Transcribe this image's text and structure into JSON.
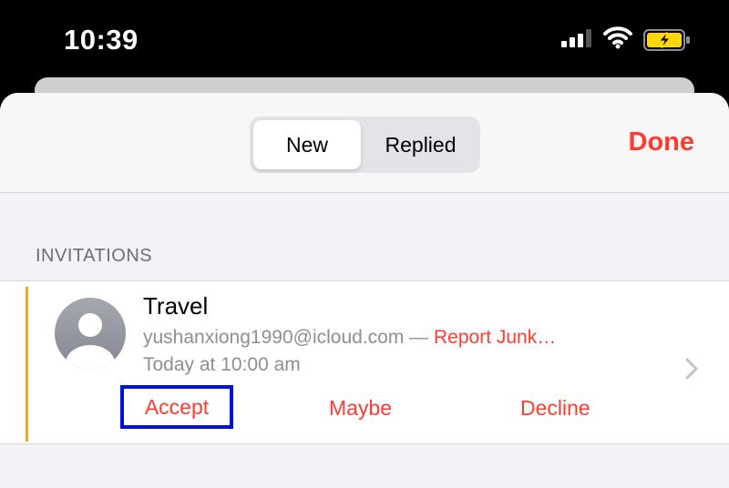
{
  "status_bar": {
    "time": "10:39"
  },
  "segments": {
    "new": "New",
    "replied": "Replied"
  },
  "nav": {
    "done": "Done"
  },
  "section": {
    "header": "INVITATIONS"
  },
  "invitation": {
    "title": "Travel",
    "email": "yushanxiong1990@icloud.com",
    "separator": " — ",
    "report_junk": "Report Junk…",
    "time": "Today at 10:00 am",
    "accept": "Accept",
    "maybe": "Maybe",
    "decline": "Decline"
  },
  "colors": {
    "accent": "#ff3b30",
    "calendar_color": "#f5a623",
    "highlight_box": "#0011dd"
  }
}
